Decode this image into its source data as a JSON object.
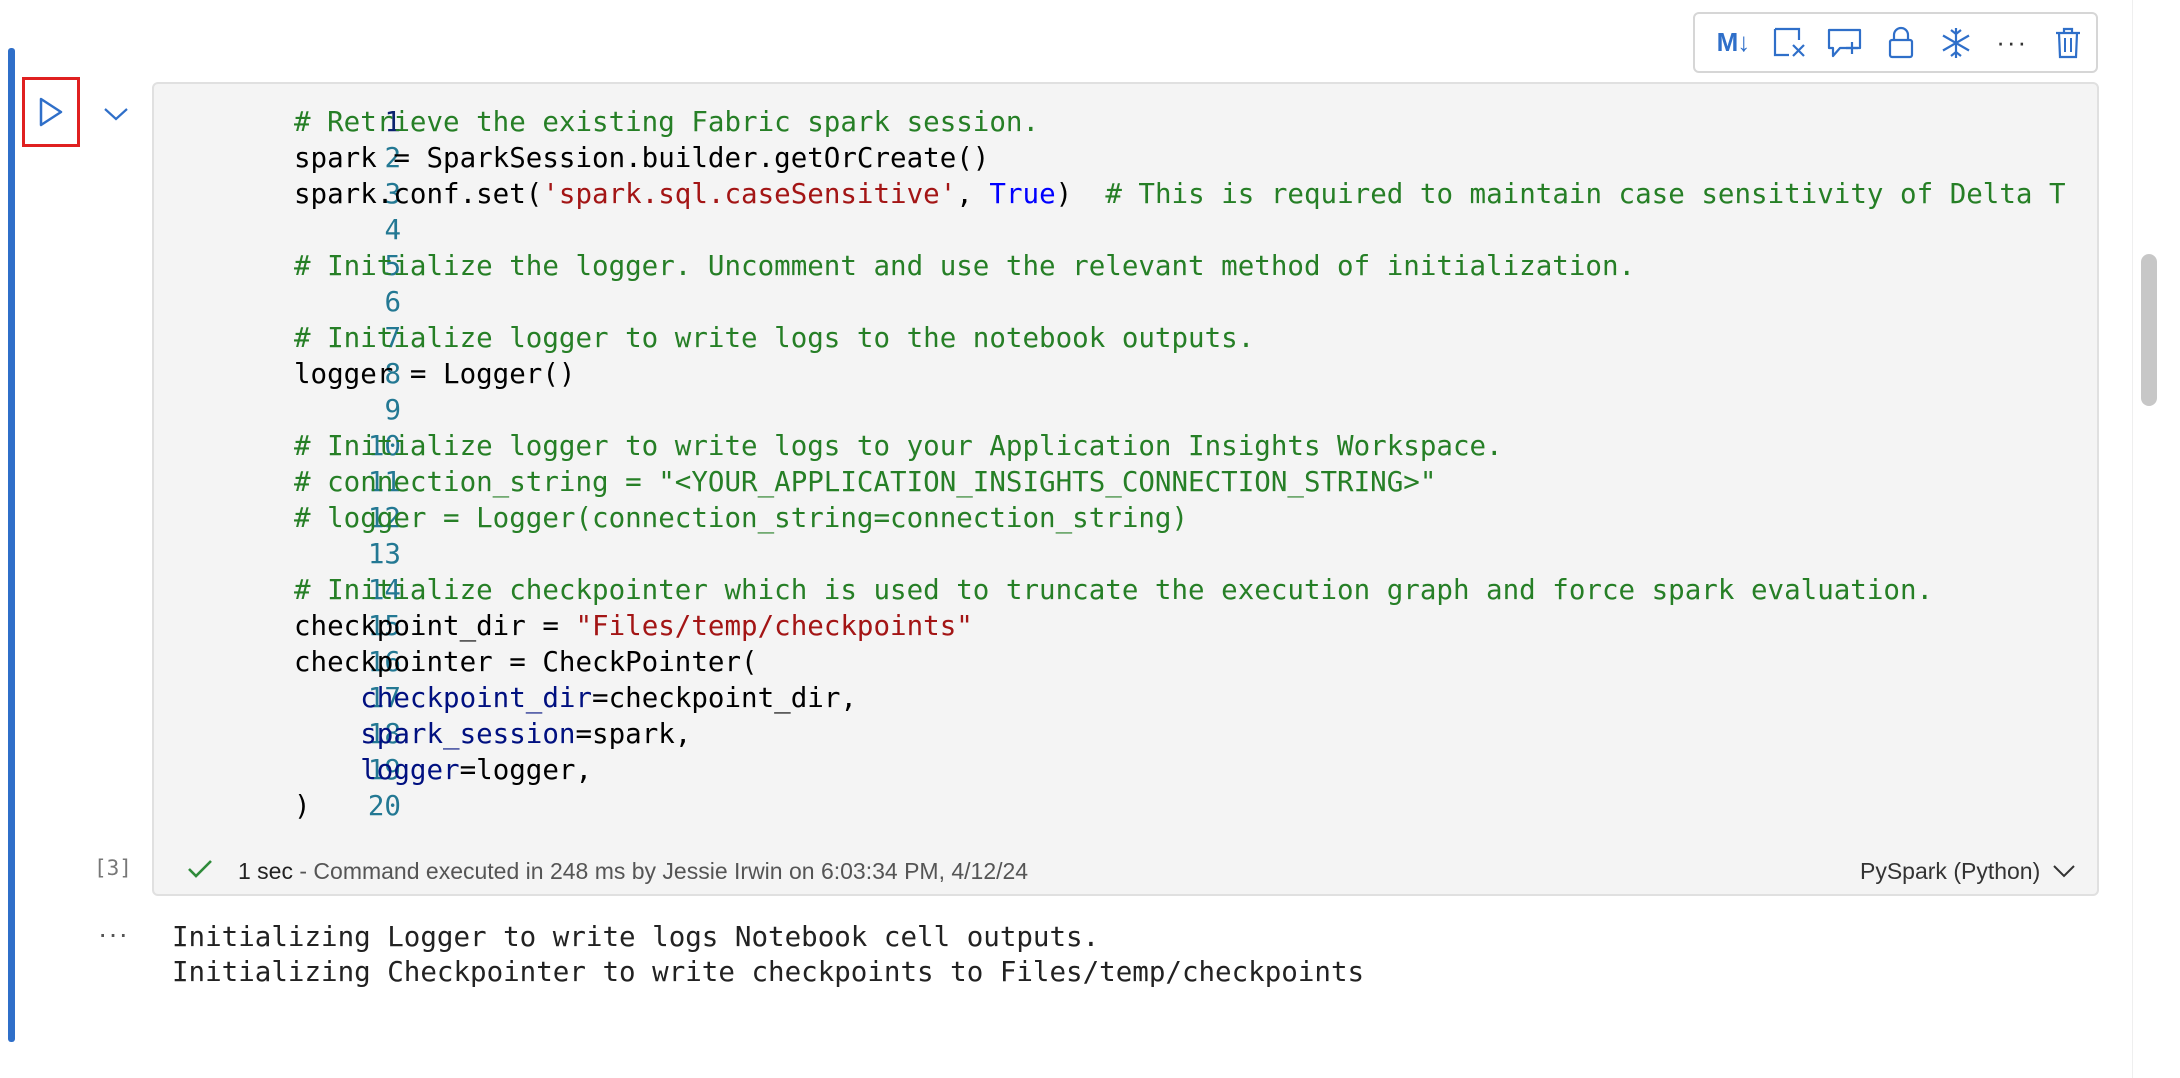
{
  "toolbar": {
    "markdown_label": "M↓",
    "icons": [
      "markdown-toggle-icon",
      "clear-output-icon",
      "add-comment-icon",
      "lock-icon",
      "freeze-icon",
      "more-options-icon",
      "delete-icon"
    ],
    "more_label": "···"
  },
  "code_lines": [
    {
      "n": "1",
      "tokens": [
        {
          "t": "# Retrieve the existing Fabric spark session.",
          "c": "comment"
        }
      ]
    },
    {
      "n": "2",
      "tokens": [
        {
          "t": "spark = SparkSession.builder.getOrCreate()",
          "c": "plain"
        }
      ]
    },
    {
      "n": "3",
      "tokens": [
        {
          "t": "spark.conf.set(",
          "c": "plain"
        },
        {
          "t": "'spark.sql.caseSensitive'",
          "c": "string"
        },
        {
          "t": ", ",
          "c": "plain"
        },
        {
          "t": "True",
          "c": "kw"
        },
        {
          "t": ")  ",
          "c": "plain"
        },
        {
          "t": "# This is required to maintain case sensitivity of Delta T",
          "c": "comment"
        }
      ]
    },
    {
      "n": "4",
      "tokens": []
    },
    {
      "n": "5",
      "tokens": [
        {
          "t": "# Initialize the logger. Uncomment and use the relevant method of initialization.",
          "c": "comment"
        }
      ]
    },
    {
      "n": "6",
      "tokens": []
    },
    {
      "n": "7",
      "tokens": [
        {
          "t": "# Initialize logger to write logs to the notebook outputs.",
          "c": "comment"
        }
      ]
    },
    {
      "n": "8",
      "tokens": [
        {
          "t": "logger = Logger()",
          "c": "plain"
        }
      ]
    },
    {
      "n": "9",
      "tokens": []
    },
    {
      "n": "10",
      "tokens": [
        {
          "t": "# Initialize logger to write logs to your Application Insights Workspace.",
          "c": "comment"
        }
      ]
    },
    {
      "n": "11",
      "tokens": [
        {
          "t": "# connection_string = \"<YOUR_APPLICATION_INSIGHTS_CONNECTION_STRING>\"",
          "c": "comment"
        }
      ]
    },
    {
      "n": "12",
      "tokens": [
        {
          "t": "# logger = Logger(connection_string=connection_string)",
          "c": "comment"
        }
      ]
    },
    {
      "n": "13",
      "tokens": []
    },
    {
      "n": "14",
      "tokens": [
        {
          "t": "# Initialize checkpointer which is used to truncate the execution graph and force spark evaluation.",
          "c": "comment"
        }
      ]
    },
    {
      "n": "15",
      "tokens": [
        {
          "t": "checkpoint_dir = ",
          "c": "plain"
        },
        {
          "t": "\"Files/temp/checkpoints\"",
          "c": "string"
        }
      ]
    },
    {
      "n": "16",
      "tokens": [
        {
          "t": "checkpointer = CheckPointer(",
          "c": "plain"
        }
      ]
    },
    {
      "n": "17",
      "tokens": [
        {
          "t": "    ",
          "c": "plain"
        },
        {
          "t": "checkpoint_dir",
          "c": "param"
        },
        {
          "t": "=checkpoint_dir,",
          "c": "plain"
        }
      ]
    },
    {
      "n": "18",
      "tokens": [
        {
          "t": "    ",
          "c": "plain"
        },
        {
          "t": "spark_session",
          "c": "param"
        },
        {
          "t": "=spark,",
          "c": "plain"
        }
      ]
    },
    {
      "n": "19",
      "tokens": [
        {
          "t": "    ",
          "c": "plain"
        },
        {
          "t": "logger",
          "c": "param"
        },
        {
          "t": "=logger,",
          "c": "plain"
        }
      ]
    },
    {
      "n": "20",
      "tokens": [
        {
          "t": ")",
          "c": "plain"
        }
      ]
    }
  ],
  "status": {
    "duration": "1 sec",
    "message": " - Command executed in 248 ms by Jessie Irwin on 6:03:34 PM, 4/12/24",
    "language": "PySpark (Python)",
    "exec_count": "[3]"
  },
  "output": {
    "menu_label": "···",
    "lines": [
      "Initializing Logger to write logs Notebook cell outputs.",
      "Initializing Checkpointer to write checkpoints to Files/temp/checkpoints"
    ]
  },
  "colors": {
    "focus": "#2f6fc9",
    "run_highlight": "#e02020",
    "comment": "#267f26",
    "string": "#a31515",
    "keyword": "#0000ff",
    "param": "#001080"
  }
}
